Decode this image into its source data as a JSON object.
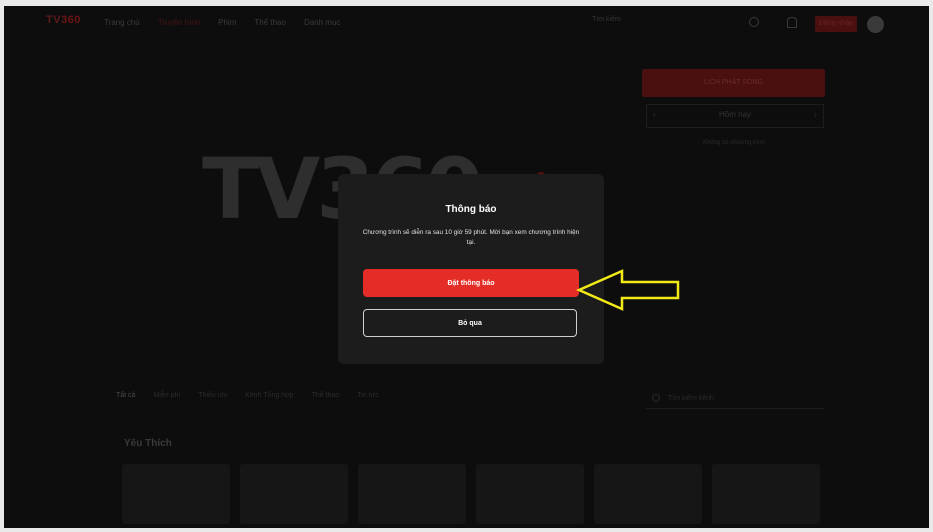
{
  "header": {
    "logo_prefix": "TV",
    "logo_accent": "360",
    "nav": [
      "Trang chủ",
      "Truyền hình",
      "Phim",
      "Thể thao",
      "Danh mục"
    ],
    "search_placeholder": "Tìm kiếm",
    "login_label": "Đăng nhập"
  },
  "promo": {
    "button_label": "LỊCH PHÁT SÓNG",
    "schedule_prev": "‹",
    "schedule_current": "Hôm nay",
    "schedule_next": "›",
    "subtext": "Không có chương trình"
  },
  "hero": {
    "logo_text": "TV360"
  },
  "filters": {
    "items": [
      "Tất cả",
      "Miễn phí",
      "Thiếu nhi",
      "Kênh Tổng hợp",
      "Thể thao",
      "Tin tức"
    ],
    "search_placeholder": "Tìm kiếm kênh"
  },
  "section": {
    "title": "Yêu Thích"
  },
  "dialog": {
    "title": "Thông báo",
    "message": "Chương trình sẽ diễn ra sau 10 giờ 59 phút. Mời bạn xem chương trình hiện tại.",
    "primary_label": "Đặt thông báo",
    "secondary_label": "Bỏ qua"
  },
  "colors": {
    "accent": "#e52d27",
    "arrow": "#f2ea17"
  }
}
